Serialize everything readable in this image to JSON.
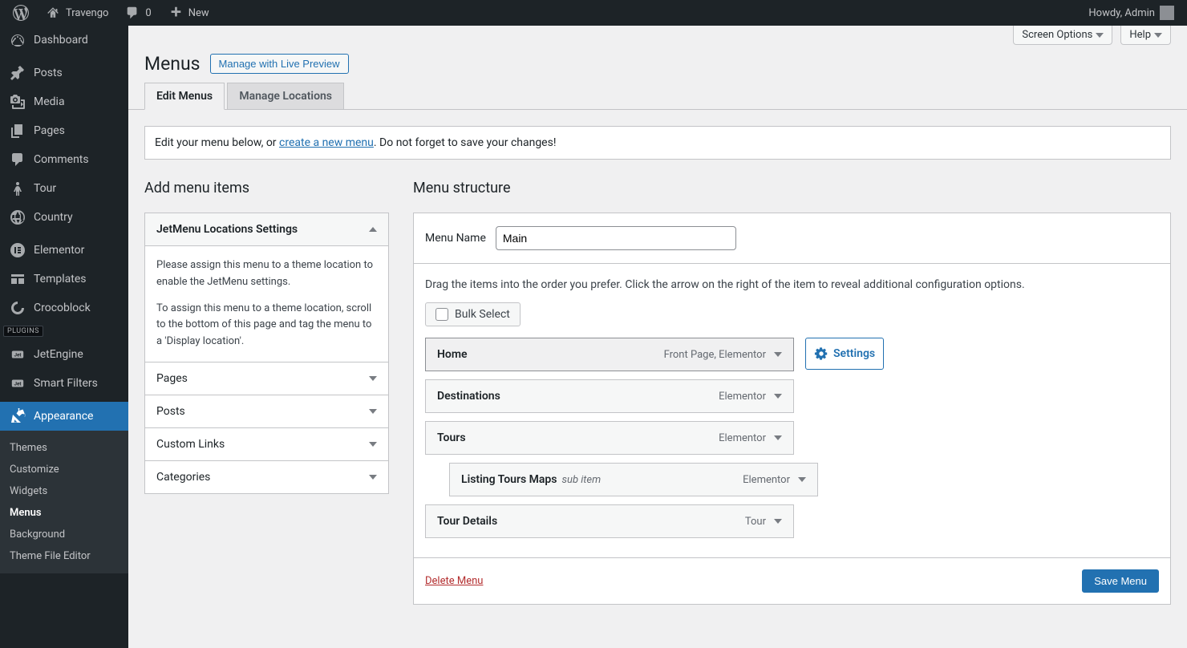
{
  "adminbar": {
    "site_title": "Travengo",
    "comments_count": "0",
    "new_label": "New",
    "howdy": "Howdy, Admin"
  },
  "sidebar": {
    "items": [
      {
        "label": "Dashboard"
      },
      {
        "label": "Posts"
      },
      {
        "label": "Media"
      },
      {
        "label": "Pages"
      },
      {
        "label": "Comments"
      },
      {
        "label": "Tour"
      },
      {
        "label": "Country"
      },
      {
        "label": "Elementor"
      },
      {
        "label": "Templates"
      },
      {
        "label": "Crocoblock"
      },
      {
        "label": "JetEngine"
      },
      {
        "label": "Smart Filters"
      },
      {
        "label": "Appearance"
      }
    ],
    "plugins_label": "PLUGINS",
    "submenu": [
      {
        "label": "Themes"
      },
      {
        "label": "Customize"
      },
      {
        "label": "Widgets"
      },
      {
        "label": "Menus"
      },
      {
        "label": "Background"
      },
      {
        "label": "Theme File Editor"
      }
    ]
  },
  "top_buttons": {
    "screen_options": "Screen Options",
    "help": "Help"
  },
  "page": {
    "title": "Menus",
    "live_preview_btn": "Manage with Live Preview"
  },
  "tabs": {
    "edit": "Edit Menus",
    "locations": "Manage Locations"
  },
  "notice": {
    "pre": "Edit your menu below, or ",
    "link": "create a new menu",
    "post": ". Do not forget to save your changes!"
  },
  "left_col": {
    "heading": "Add menu items",
    "jetmenu": {
      "title": "JetMenu Locations Settings",
      "p1": "Please assign this menu to a theme location to enable the JetMenu settings.",
      "p2": "To assign this menu to a theme location, scroll to the bottom of this page and tag the menu to a 'Display location'."
    },
    "panels": [
      "Pages",
      "Posts",
      "Custom Links",
      "Categories"
    ]
  },
  "right_col": {
    "heading": "Menu structure",
    "menu_name_label": "Menu Name",
    "menu_name_value": "Main",
    "drag_hint": "Drag the items into the order you prefer. Click the arrow on the right of the item to reveal additional configuration options.",
    "bulk_select": "Bulk Select",
    "settings_btn": "Settings",
    "items": [
      {
        "title": "Home",
        "type": "Front Page, Elementor",
        "depth": 0,
        "selected": true,
        "has_settings": true
      },
      {
        "title": "Destinations",
        "type": "Elementor",
        "depth": 0
      },
      {
        "title": "Tours",
        "type": "Elementor",
        "depth": 0
      },
      {
        "title": "Listing Tours Maps",
        "sub": "sub item",
        "type": "Elementor",
        "depth": 1
      },
      {
        "title": "Tour Details",
        "type": "Tour",
        "depth": 0
      }
    ],
    "delete_link": "Delete Menu",
    "save_btn": "Save Menu"
  }
}
